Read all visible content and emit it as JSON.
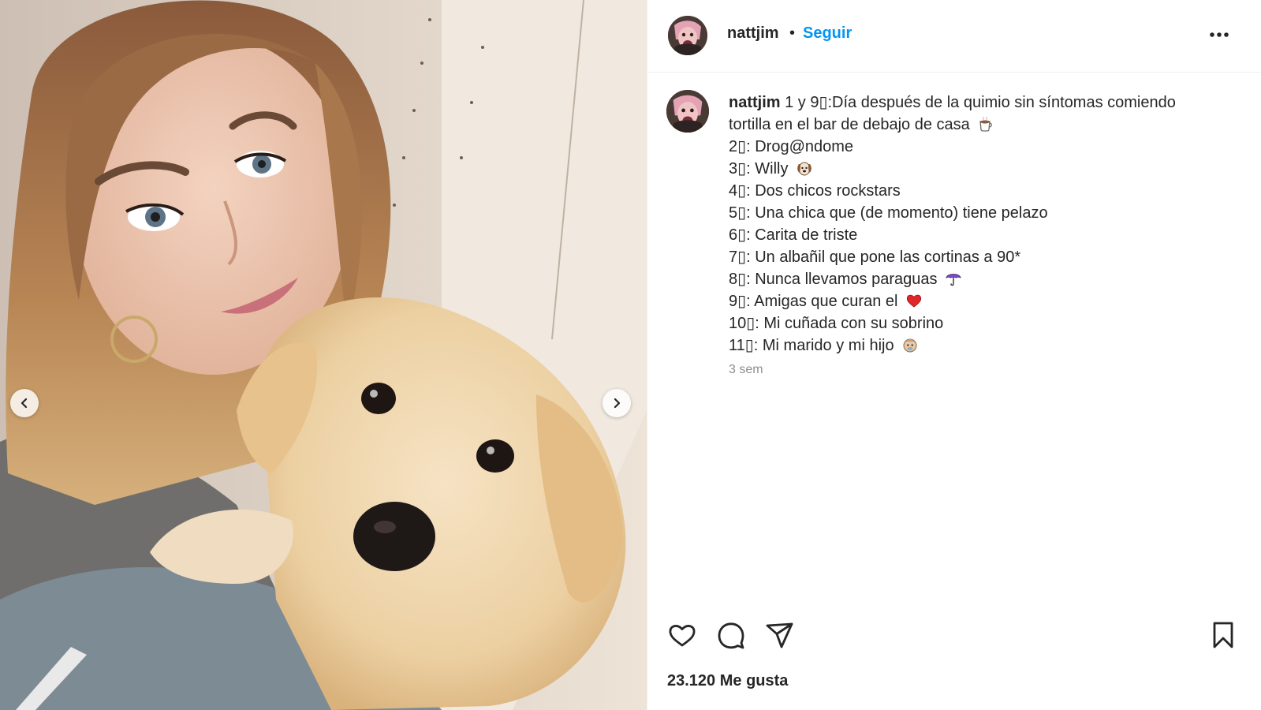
{
  "post": {
    "username": "nattjim",
    "separator": "•",
    "follow_label": "Seguir",
    "more_icon": "more-options-icon"
  },
  "caption": {
    "username": "nattjim",
    "lines": [
      "1 y 9▯:Día después de la quimio sin síntomas comiendo",
      "tortilla en el bar de debajo de casa",
      "2▯: Drog@ndome",
      "3▯: Willy",
      "4▯: Dos chicos rockstars",
      "5▯: Una chica que (de momento) tiene pelazo",
      "6▯: Carita de triste",
      "7▯: Un albañil que pone las cortinas a 90*",
      "8▯: Nunca llevamos paraguas",
      "9▯: Amigas que curan el",
      "10▯: Mi cuñada con su sobrino",
      "11▯: Mi marido y mi hijo"
    ],
    "emojis": {
      "line_1": "coffee-emoji",
      "line_3": "dog-emoji",
      "line_8": "umbrella-emoji",
      "line_9": "red-heart-emoji",
      "line_11": "baby-emoji"
    },
    "time_ago": "3 sem"
  },
  "carousel": {
    "prev_icon": "chevron-left-icon",
    "next_icon": "chevron-right-icon"
  },
  "actions": {
    "like_icon": "heart-icon",
    "comment_icon": "comment-icon",
    "share_icon": "send-icon",
    "save_icon": "bookmark-icon"
  },
  "likes_text": "23.120 Me gusta",
  "colors": {
    "link_blue": "#0095f6",
    "text": "#262626",
    "muted": "#8e8e8e",
    "divider": "#efefef"
  }
}
